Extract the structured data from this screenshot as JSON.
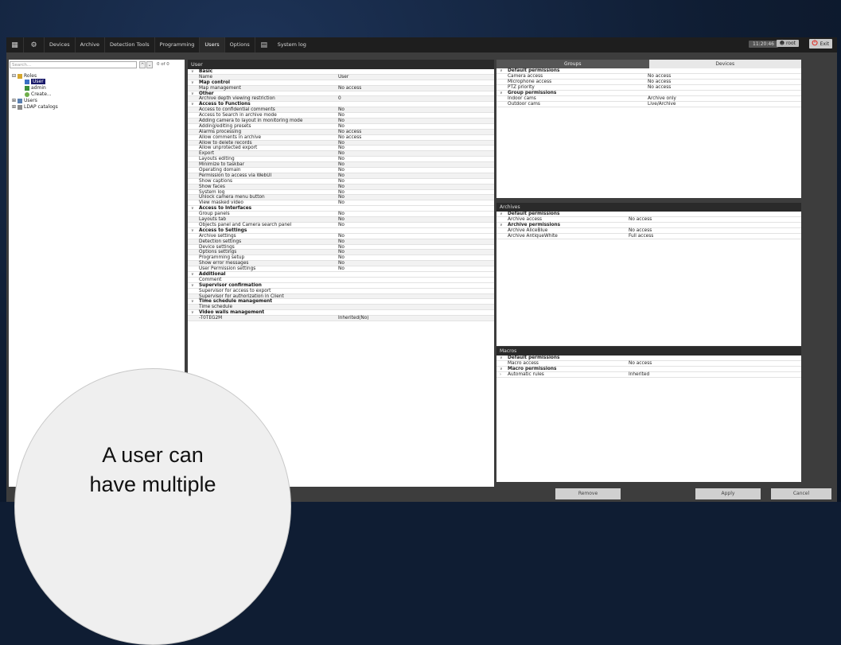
{
  "topbar": {
    "items": [
      "Devices",
      "Archive",
      "Detection Tools",
      "Programming",
      "Users",
      "Options",
      "System log"
    ],
    "active": "Users",
    "clock": "11:20:46",
    "user": "root",
    "exit": "Exit"
  },
  "left": {
    "search_placeholder": "Search...",
    "count": "0 of 0",
    "tree": [
      "Roles",
      "User",
      "admin",
      "Create...",
      "Users",
      "LDAP catalogs"
    ]
  },
  "mid": {
    "title": "User",
    "rows": [
      {
        "type": "sec",
        "k": "Basic"
      },
      {
        "k": "Name",
        "v": "User"
      },
      {
        "type": "sec",
        "k": "Map control"
      },
      {
        "k": "Map management",
        "v": "No access"
      },
      {
        "type": "sec",
        "k": "Other"
      },
      {
        "k": "Archive depth viewing restriction",
        "v": "0"
      },
      {
        "type": "sec",
        "k": "Access to Functions"
      },
      {
        "k": "Access to confidential comments",
        "v": "No"
      },
      {
        "k": "Access to Search in archive mode",
        "v": "No"
      },
      {
        "k": "Adding camera to layout in monitoring mode",
        "v": "No"
      },
      {
        "k": "Adding/editing presets",
        "v": "No"
      },
      {
        "k": "Alarms processing",
        "v": "No access"
      },
      {
        "k": "Allow comments in archive",
        "v": "No access"
      },
      {
        "k": "Allow to delete records",
        "v": "No"
      },
      {
        "k": "Allow unprotected export",
        "v": "No"
      },
      {
        "k": "Export",
        "v": "No"
      },
      {
        "k": "Layouts editing",
        "v": "No"
      },
      {
        "k": "Minimize to taskbar",
        "v": "No"
      },
      {
        "k": "Operating domain",
        "v": "No"
      },
      {
        "k": "Permission to access via WebUI",
        "v": "No"
      },
      {
        "k": "Show captions",
        "v": "No"
      },
      {
        "k": "Show faces",
        "v": "No"
      },
      {
        "k": "System log",
        "v": "No"
      },
      {
        "k": "Unlock camera menu button",
        "v": "No"
      },
      {
        "k": "View masked video",
        "v": "No"
      },
      {
        "type": "sec",
        "k": "Access to Interfaces"
      },
      {
        "k": "Group panels",
        "v": "No"
      },
      {
        "k": "Layouts tab",
        "v": "No"
      },
      {
        "k": "Objects panel and Camera search panel",
        "v": "No"
      },
      {
        "type": "sec",
        "k": "Access to Settings"
      },
      {
        "k": "Archive settings",
        "v": "No"
      },
      {
        "k": "Detection settings",
        "v": "No"
      },
      {
        "k": "Device settings",
        "v": "No"
      },
      {
        "k": "Options settings",
        "v": "No"
      },
      {
        "k": "Programming setup",
        "v": "No"
      },
      {
        "k": "Show error messages",
        "v": "No"
      },
      {
        "k": "User Permission settings",
        "v": "No"
      },
      {
        "type": "sec",
        "k": "Additional"
      },
      {
        "k": "Comment",
        "v": ""
      },
      {
        "type": "sec",
        "k": "Supervisor confirmation"
      },
      {
        "k": "Supervisor for access to export",
        "v": ""
      },
      {
        "k": "Supervisor for authorization in Client",
        "v": ""
      },
      {
        "type": "sec",
        "k": "Time schedule management"
      },
      {
        "k": "Time schedule",
        "v": ""
      },
      {
        "type": "sec",
        "k": "Video walls management"
      },
      {
        "k": "-T0TEG2M",
        "v": "Inherited(No)"
      }
    ]
  },
  "right": {
    "tabs": [
      "Groups",
      "Devices"
    ],
    "groups": [
      {
        "type": "sec",
        "k": "Default permissions"
      },
      {
        "k": "Camera access",
        "v": "No access"
      },
      {
        "k": "Microphone access",
        "v": "No access"
      },
      {
        "k": "PTZ priority",
        "v": "No access"
      },
      {
        "type": "sec",
        "k": "Group permissions"
      },
      {
        "k": "Indoor cams",
        "v": "Archive only"
      },
      {
        "k": "Outdoor cams",
        "v": "Live/Archive"
      }
    ],
    "archives_title": "Archives",
    "archives": [
      {
        "type": "sec",
        "k": "Default permissions"
      },
      {
        "k": "Archive access",
        "v": "No access"
      },
      {
        "type": "sec",
        "k": "Archive permissions"
      },
      {
        "k": "Archive AliceBlue",
        "v": "No access"
      },
      {
        "k": "Archive AntiqueWhite",
        "v": "Full access"
      }
    ],
    "macros_title": "Macros",
    "macros": [
      {
        "type": "sec",
        "k": "Default permissions"
      },
      {
        "k": "Macro access",
        "v": "No access"
      },
      {
        "type": "sec",
        "k": "Macro permissions"
      },
      {
        "k": "Automatic rules",
        "v": "Inherited",
        "collapsed": true
      }
    ]
  },
  "buttons": {
    "remove": "Remove",
    "apply": "Apply",
    "cancel": "Cancel"
  },
  "callout": {
    "line1": "A user can",
    "line2": "have multiple"
  }
}
